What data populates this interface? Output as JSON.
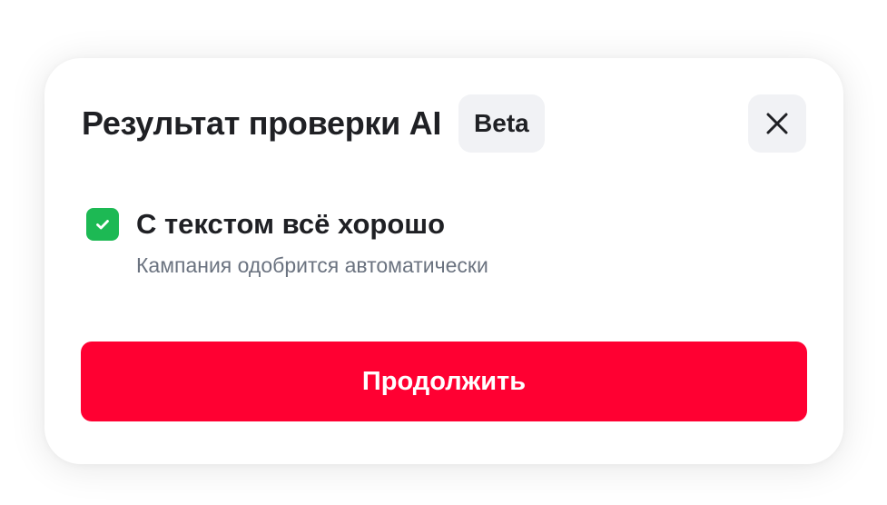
{
  "dialog": {
    "title": "Результат проверки AI",
    "badge": "Beta",
    "close_icon": "close-icon"
  },
  "result": {
    "icon": "checkmark-icon",
    "icon_color": "#1db954",
    "title": "С текстом всё хорошо",
    "subtitle": "Кампания одобрится автоматически"
  },
  "actions": {
    "continue_label": "Продолжить",
    "continue_color": "#ff0032"
  }
}
